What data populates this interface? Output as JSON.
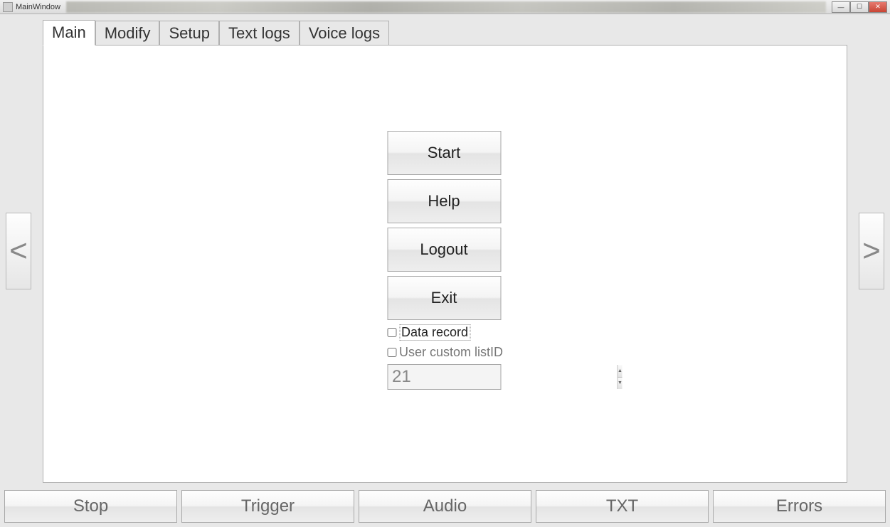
{
  "window": {
    "title": "MainWindow"
  },
  "tabs": [
    {
      "label": "Main",
      "active": true
    },
    {
      "label": "Modify",
      "active": false
    },
    {
      "label": "Setup",
      "active": false
    },
    {
      "label": "Text logs",
      "active": false
    },
    {
      "label": "Voice logs",
      "active": false
    }
  ],
  "nav": {
    "prev": "<",
    "next": ">"
  },
  "main_buttons": {
    "start": "Start",
    "help": "Help",
    "logout": "Logout",
    "exit": "Exit"
  },
  "checkboxes": {
    "data_record": {
      "label": "Data record",
      "checked": false
    },
    "user_custom_listid": {
      "label": "User custom listID",
      "checked": false
    }
  },
  "spinner": {
    "value": "21"
  },
  "bottom_bar": {
    "stop": "Stop",
    "trigger": "Trigger",
    "audio": "Audio",
    "txt": "TXT",
    "errors": "Errors"
  }
}
